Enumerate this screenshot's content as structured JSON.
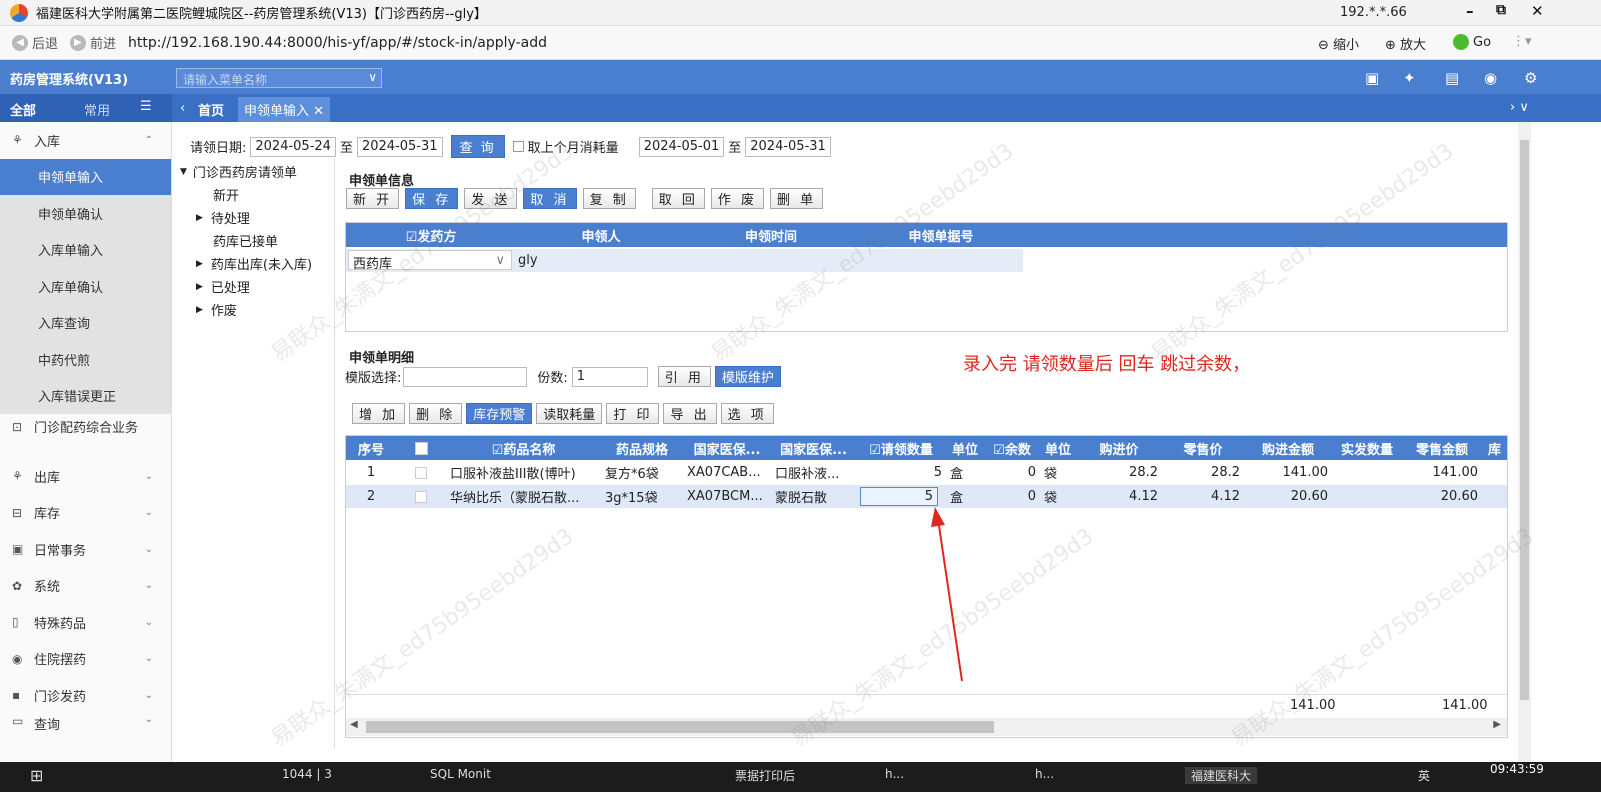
{
  "window": {
    "title": "福建医科大学附属第二医院鲤城院区--药房管理系统(V13)【门诊西药房--gly】",
    "ip": "192.*.*.66",
    "min": "–",
    "max": "⧉",
    "close": "✕"
  },
  "browser": {
    "back": "后退",
    "forward": "前进",
    "url": "http://192.168.190.44:8000/his-yf/app/#/stock-in/apply-add",
    "zoom_out": "缩小",
    "zoom_in": "放大",
    "go": "Go"
  },
  "app": {
    "name": "药房管理系统(V13)",
    "menu_search_placeholder": "请输入菜单名称"
  },
  "tabs": {
    "all": "全部",
    "common": "常用",
    "home": "首页",
    "current": "申领单输入"
  },
  "sidebar": {
    "ruku": "入库",
    "sub": [
      "申领单输入",
      "申领单确认",
      "入库单输入",
      "入库单确认",
      "入库查询",
      "中药代煎",
      "入库错误更正"
    ],
    "groups": [
      "门诊配药综合业务",
      "出库",
      "库存",
      "日常事务",
      "系统",
      "特殊药品",
      "住院摆药",
      "门诊发药",
      "查询"
    ]
  },
  "filter": {
    "date_label": "请领日期:",
    "date_from": "2024-05-24",
    "to": "至",
    "date_to": "2024-05-31",
    "query": "查 询",
    "prev_month": "取上个月消耗量",
    "date2_from": "2024-05-01",
    "date2_to": "2024-05-31"
  },
  "tree": {
    "root": "门诊西药房请领单",
    "new": "新开",
    "pending": "待处理",
    "accepted": "药库已接单",
    "out": "药库出库(未入库)",
    "done": "已处理",
    "void": "作废"
  },
  "apply_info": {
    "title": "申领单信息",
    "buttons": [
      "新 开",
      "保 存",
      "发 送",
      "取 消",
      "复 制",
      "取 回",
      "作 废",
      "删 单"
    ],
    "headers": [
      "☑发药方",
      "申领人",
      "申领时间",
      "申领单据号"
    ],
    "supplier": "西药库",
    "applicant": "gly"
  },
  "detail": {
    "title": "申领单明细",
    "template_label": "模版选择:",
    "copies_label": "份数:",
    "copies_value": "1",
    "ref": "引 用",
    "maint": "模版维护",
    "buttons": [
      "增 加",
      "删 除",
      "库存预警",
      "读取耗量",
      "打 印",
      "导 出",
      "选 项"
    ],
    "headers": [
      "序号",
      "",
      "☑药品名称",
      "药品规格",
      "国家医保...",
      "国家医保...",
      "☑请领数量",
      "单位",
      "☑余数",
      "单位",
      "购进价",
      "零售价",
      "购进金额",
      "实发数量",
      "零售金额",
      "库"
    ],
    "rows": [
      [
        "1",
        "",
        "口服补液盐III散(博叶)",
        "复方*6袋",
        "XA07CAB...",
        "口服补液...",
        "5",
        "盒",
        "0",
        "袋",
        "28.2",
        "28.2",
        "141.00",
        "",
        "141.00"
      ],
      [
        "2",
        "",
        "华纳比乐（蒙脱石散...",
        "3g*15袋",
        "XA07BCM...",
        "蒙脱石散",
        "5",
        "盒",
        "0",
        "袋",
        "4.12",
        "4.12",
        "20.60",
        "",
        "20.60"
      ]
    ],
    "footer": {
      "buy_total": "141.00",
      "sale_total": "141.00"
    }
  },
  "annotation": "录入完 请领数量后 回车 跳过余数，",
  "watermark": "易联众_朱满文_ed75b95eebd29d3",
  "taskbar": {
    "items": [
      "1044 | 3",
      "SQL Monit",
      "票据打印后",
      "h...",
      "h...",
      "福建医科大"
    ],
    "time": "09:43:59",
    "lang": "英"
  }
}
